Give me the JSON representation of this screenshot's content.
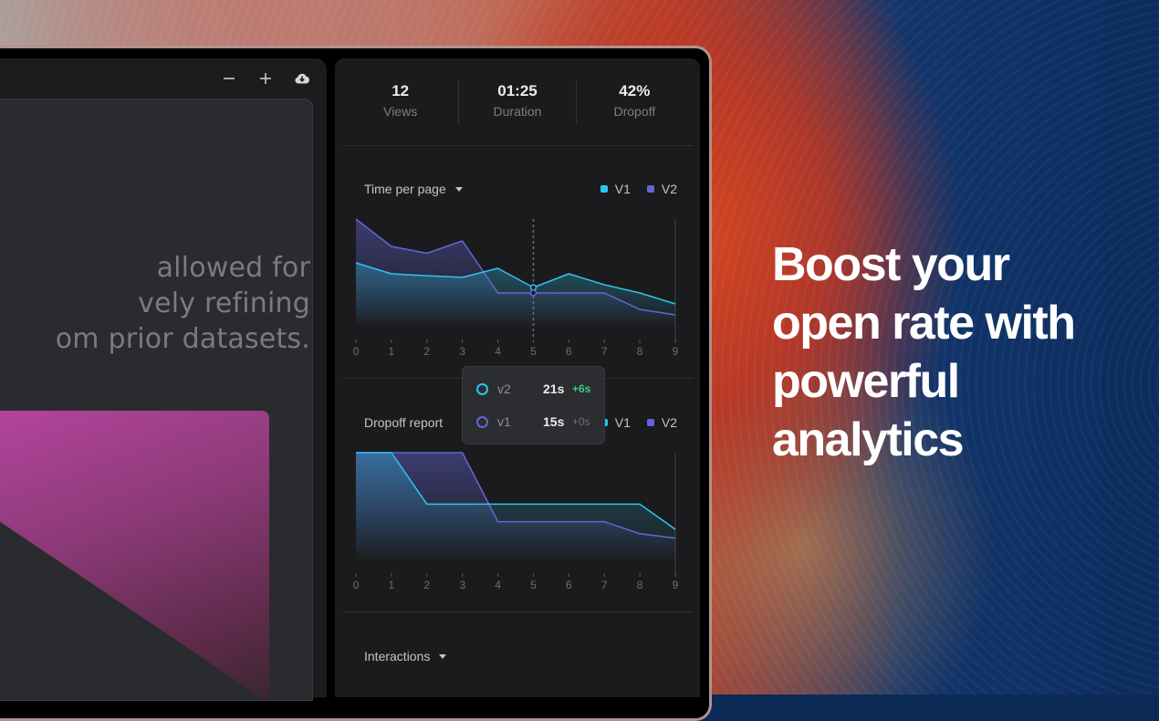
{
  "headline": {
    "lines": [
      "Boost your",
      "open rate with",
      "powerful",
      "analytics"
    ]
  },
  "left_panel": {
    "toolbar": {
      "zoom_out_icon": "minus-icon",
      "zoom_in_icon": "plus-icon",
      "download_icon": "cloud-download-icon"
    },
    "canvas_text_lines": [
      "allowed for",
      "vely refining",
      "om prior datasets."
    ]
  },
  "stats": [
    {
      "value": "12",
      "label": "Views"
    },
    {
      "value": "01:25",
      "label": "Duration"
    },
    {
      "value": "42%",
      "label": "Dropoff"
    }
  ],
  "colors": {
    "v1": "#2ec4ef",
    "v2": "#6366d6",
    "positive": "#2fd37a",
    "muted": "#6e6f73"
  },
  "sections": {
    "time_per_page": {
      "title": "Time per page",
      "legend": [
        "V1",
        "V2"
      ]
    },
    "dropoff_report": {
      "title": "Dropoff report",
      "legend": [
        "V1",
        "V2"
      ]
    },
    "interactions": {
      "title": "Interactions"
    }
  },
  "tooltip": {
    "rows": [
      {
        "name": "v2",
        "value": "21s",
        "delta": "+6s",
        "series": "v1"
      },
      {
        "name": "v1",
        "value": "15s",
        "delta": "+0s",
        "series": "v2"
      }
    ]
  },
  "chart_data": [
    {
      "type": "area",
      "title": "Time per page",
      "x": [
        0,
        1,
        2,
        3,
        4,
        5,
        6,
        7,
        8,
        9
      ],
      "x_ticks": [
        "0",
        "1",
        "2",
        "3",
        "4",
        "5",
        "6",
        "7",
        "8",
        "9"
      ],
      "ylim": [
        0,
        40
      ],
      "series": [
        {
          "name": "V1",
          "values": [
            24,
            20,
            19.3,
            18.7,
            22,
            15,
            20,
            16,
            13,
            9
          ]
        },
        {
          "name": "V2",
          "values": [
            40,
            30,
            27.5,
            32,
            13,
            13,
            13,
            13,
            7,
            5
          ]
        }
      ],
      "hover_x": 5,
      "legend": "top-right"
    },
    {
      "type": "area",
      "title": "Dropoff report",
      "x": [
        0,
        1,
        2,
        3,
        4,
        5,
        6,
        7,
        8,
        9
      ],
      "x_ticks": [
        "0",
        "1",
        "2",
        "3",
        "4",
        "5",
        "6",
        "7",
        "8",
        "9"
      ],
      "ylim": [
        0,
        100
      ],
      "series": [
        {
          "name": "V1",
          "values": [
            100,
            100,
            53,
            53,
            53,
            53,
            53,
            53,
            53,
            30
          ]
        },
        {
          "name": "V2",
          "values": [
            100,
            100,
            100,
            100,
            37,
            37,
            37,
            37,
            26,
            22
          ]
        }
      ],
      "legend": "top-right"
    }
  ]
}
